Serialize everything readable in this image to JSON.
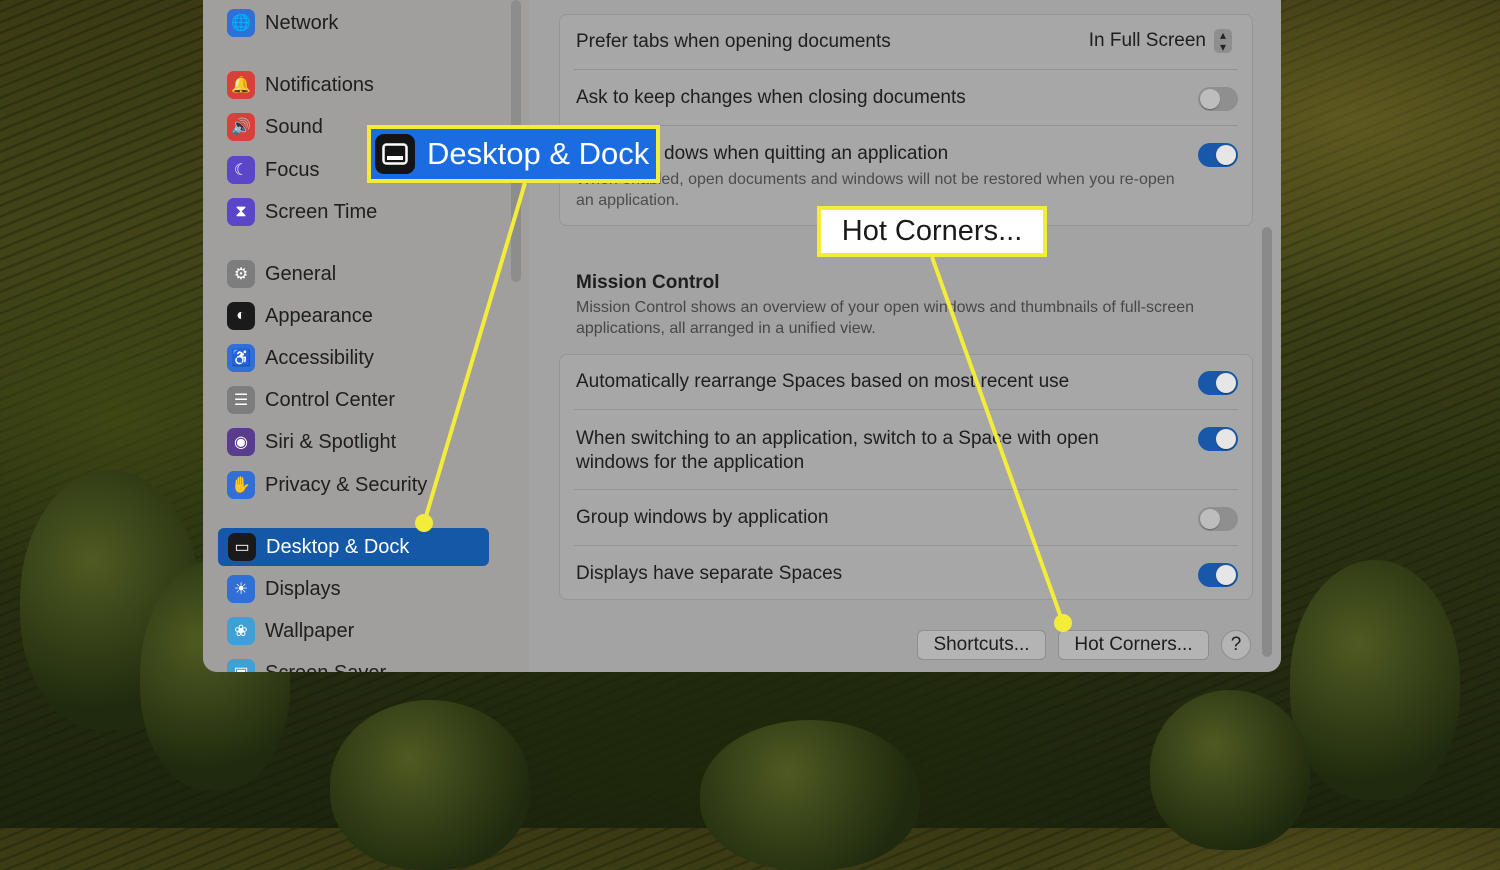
{
  "sidebar": {
    "items": [
      {
        "label": "Network",
        "icon": "globe-icon",
        "color": "#2f6fd6"
      },
      {
        "label": "Notifications",
        "icon": "bell-icon",
        "color": "#d9403a"
      },
      {
        "label": "Sound",
        "icon": "speaker-icon",
        "color": "#d9403a"
      },
      {
        "label": "Focus",
        "icon": "moon-icon",
        "color": "#5b45c9"
      },
      {
        "label": "Screen Time",
        "icon": "hourglass-icon",
        "color": "#5b45c9"
      },
      {
        "label": "General",
        "icon": "gear-icon",
        "color": "#7d7d7d"
      },
      {
        "label": "Appearance",
        "icon": "appearance-icon",
        "color": "#1a1a1a"
      },
      {
        "label": "Accessibility",
        "icon": "accessibility-icon",
        "color": "#2f6fd6"
      },
      {
        "label": "Control Center",
        "icon": "control-center-icon",
        "color": "#7d7d7d"
      },
      {
        "label": "Siri & Spotlight",
        "icon": "siri-icon",
        "color": "#5a3c8f"
      },
      {
        "label": "Privacy & Security",
        "icon": "hand-icon",
        "color": "#2f6fd6"
      },
      {
        "label": "Desktop & Dock",
        "icon": "dock-icon",
        "color": "#1a1a1a",
        "selected": true
      },
      {
        "label": "Displays",
        "icon": "sun-icon",
        "color": "#2f6fd6"
      },
      {
        "label": "Wallpaper",
        "icon": "flower-icon",
        "color": "#3ea0d6"
      },
      {
        "label": "Screen Saver",
        "icon": "screen-saver-icon",
        "color": "#3ea0d6"
      }
    ]
  },
  "windows_panel": {
    "prefer_tabs_label": "Prefer tabs when opening documents",
    "prefer_tabs_value": "In Full Screen",
    "ask_keep_changes_label": "Ask to keep changes when closing documents",
    "ask_keep_changes_on": false,
    "close_windows_label": "Close windows when quitting an application",
    "close_windows_visible": "dows when quitting an application",
    "close_windows_sub": "When enabled, open documents and windows will not be restored when you re-open an application.",
    "close_windows_on": true
  },
  "mission_control": {
    "title": "Mission Control",
    "description": "Mission Control shows an overview of your open windows and thumbnails of full-screen applications, all arranged in a unified view.",
    "rows": [
      {
        "label": "Automatically rearrange Spaces based on most recent use",
        "on": true
      },
      {
        "label": "When switching to an application, switch to a Space with open windows for the application",
        "on": true
      },
      {
        "label": "Group windows by application",
        "on": false
      },
      {
        "label": "Displays have separate Spaces",
        "on": true
      }
    ]
  },
  "buttons": {
    "shortcuts": "Shortcuts...",
    "hot_corners": "Hot Corners...",
    "help": "?"
  },
  "callouts": {
    "desktop_dock": "Desktop & Dock",
    "hot_corners": "Hot Corners...",
    "highlight_color": "#f4ec3a",
    "accent_blue": "#1b6ce0"
  }
}
